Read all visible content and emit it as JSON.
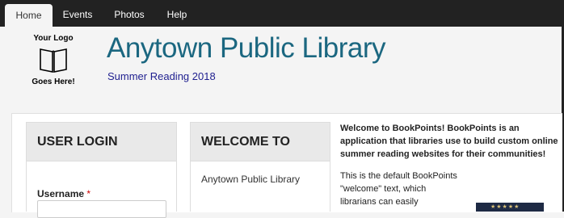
{
  "nav": {
    "tabs": [
      {
        "label": "Home",
        "active": true
      },
      {
        "label": "Events",
        "active": false
      },
      {
        "label": "Photos",
        "active": false
      },
      {
        "label": "Help",
        "active": false
      }
    ]
  },
  "header": {
    "logo_lines": [
      "Your Logo",
      "Goes Here!"
    ],
    "title": "Anytown Public Library",
    "subtitle": "Summer Reading 2018"
  },
  "login": {
    "heading": "USER LOGIN",
    "username_label": "Username",
    "required_mark": "*",
    "username_value": ""
  },
  "welcome": {
    "heading": "WELCOME TO",
    "body": "Anytown Public Library"
  },
  "intro": {
    "bold_text": "Welcome to BookPoints!  BookPoints is an application that libraries use to build custom online summer reading websites for their communities!",
    "body_text": "This is the default BookPoints \"welcome\" text, which librarians can easily"
  },
  "colors": {
    "nav_bg": "#222222",
    "title": "#1b6780",
    "subtitle": "#1f1f8f",
    "required": "#cc0000"
  }
}
